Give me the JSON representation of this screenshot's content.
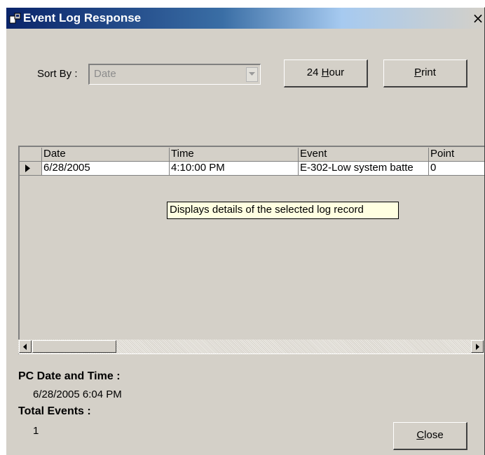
{
  "window": {
    "title": "Event Log Response",
    "close_glyph": "×"
  },
  "sort": {
    "label": "Sort By :",
    "selected": "Date"
  },
  "buttons": {
    "hour_prefix": "24 ",
    "hour_mnemonic": "H",
    "hour_rest": "our",
    "print_mnemonic": "P",
    "print_rest": "rint",
    "close_mnemonic": "C",
    "close_rest": "lose"
  },
  "grid": {
    "columns": [
      "Date",
      "Time",
      "Event",
      "Point"
    ],
    "rows": [
      [
        "6/28/2005",
        "4:10:00 PM",
        "E-302-Low system batte",
        "0"
      ]
    ],
    "row_indicator": "current-row-arrow-icon"
  },
  "tooltip": "Displays details of the selected log record",
  "info": {
    "pc_label": "PC Date and Time :",
    "pc_value": "6/28/2005 6:04 PM",
    "total_label": "Total Events :",
    "total_value": "1"
  },
  "colors": {
    "face": "#d4d0c8",
    "title_start": "#0a246a",
    "title_end": "#a6caf0",
    "tooltip_bg": "#ffffe1"
  }
}
